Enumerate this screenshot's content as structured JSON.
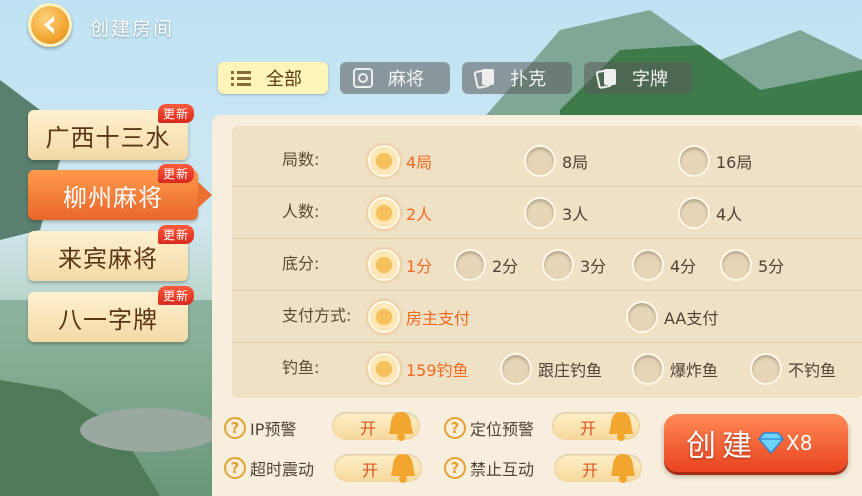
{
  "header": {
    "title": "创建房间"
  },
  "tabs": [
    {
      "label": "全部",
      "icon": "list-icon",
      "active": true
    },
    {
      "label": "麻将",
      "icon": "mahjong-icon",
      "active": false
    },
    {
      "label": "扑克",
      "icon": "poker-icon",
      "active": false
    },
    {
      "label": "字牌",
      "icon": "zipai-icon",
      "active": false
    }
  ],
  "games": [
    {
      "label": "广西十三水",
      "badge": "更新",
      "selected": false
    },
    {
      "label": "柳州麻将",
      "badge": "更新",
      "selected": true
    },
    {
      "label": "来宾麻将",
      "badge": "更新",
      "selected": false
    },
    {
      "label": "八一字牌",
      "badge": "更新",
      "selected": false
    }
  ],
  "options": [
    {
      "label": "局数:",
      "choices": [
        "4局",
        "8局",
        "16局"
      ],
      "selected": 0
    },
    {
      "label": "人数:",
      "choices": [
        "2人",
        "3人",
        "4人"
      ],
      "selected": 0
    },
    {
      "label": "底分:",
      "choices": [
        "1分",
        "2分",
        "3分",
        "4分",
        "5分"
      ],
      "selected": 0
    },
    {
      "label": "支付方式:",
      "choices": [
        "房主支付",
        "AA支付"
      ],
      "selected": 0
    },
    {
      "label": "钓鱼:",
      "choices": [
        "159钓鱼",
        "跟庄钓鱼",
        "爆炸鱼",
        "不钓鱼"
      ],
      "selected": 0
    }
  ],
  "toggles": [
    {
      "label": "IP预警",
      "value": "开",
      "help": "?"
    },
    {
      "label": "定位预警",
      "value": "开",
      "help": "?"
    },
    {
      "label": "超时震动",
      "value": "开",
      "help": "?"
    },
    {
      "label": "禁止互动",
      "value": "开",
      "help": "?"
    }
  ],
  "create": {
    "label": "创建",
    "cost": "X8",
    "cost_icon": "diamond-icon"
  },
  "colors": {
    "accent": "#f06a1f",
    "tab_active": "#fff5b9",
    "create": "#e9431f"
  }
}
